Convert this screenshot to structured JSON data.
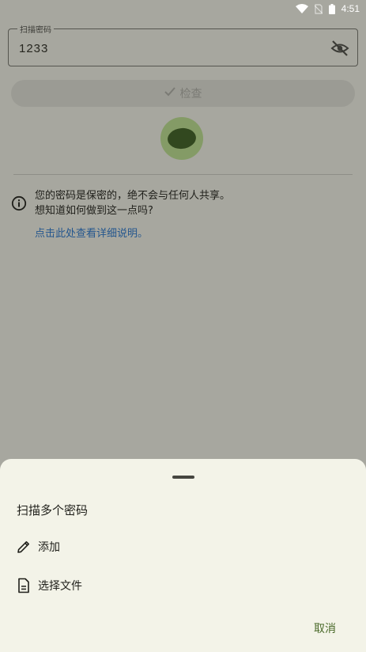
{
  "status_bar": {
    "time": "4:51"
  },
  "password_field": {
    "label": "扫描密码",
    "value": "1233"
  },
  "check_button": {
    "label": "检查"
  },
  "info": {
    "line1": "您的密码是保密的，绝不会与任何人共享。",
    "line2": "想知道如何做到这一点吗?",
    "link": "点击此处查看详细说明。"
  },
  "sheet": {
    "title": "扫描多个密码",
    "items": [
      {
        "label": "添加",
        "icon": "pencil-icon"
      },
      {
        "label": "选择文件",
        "icon": "document-icon"
      }
    ],
    "cancel": "取消"
  },
  "colors": {
    "background": "#a7a79f",
    "sheet": "#f3f3e8",
    "link": "#25578e",
    "accent": "#4a6a2a"
  }
}
